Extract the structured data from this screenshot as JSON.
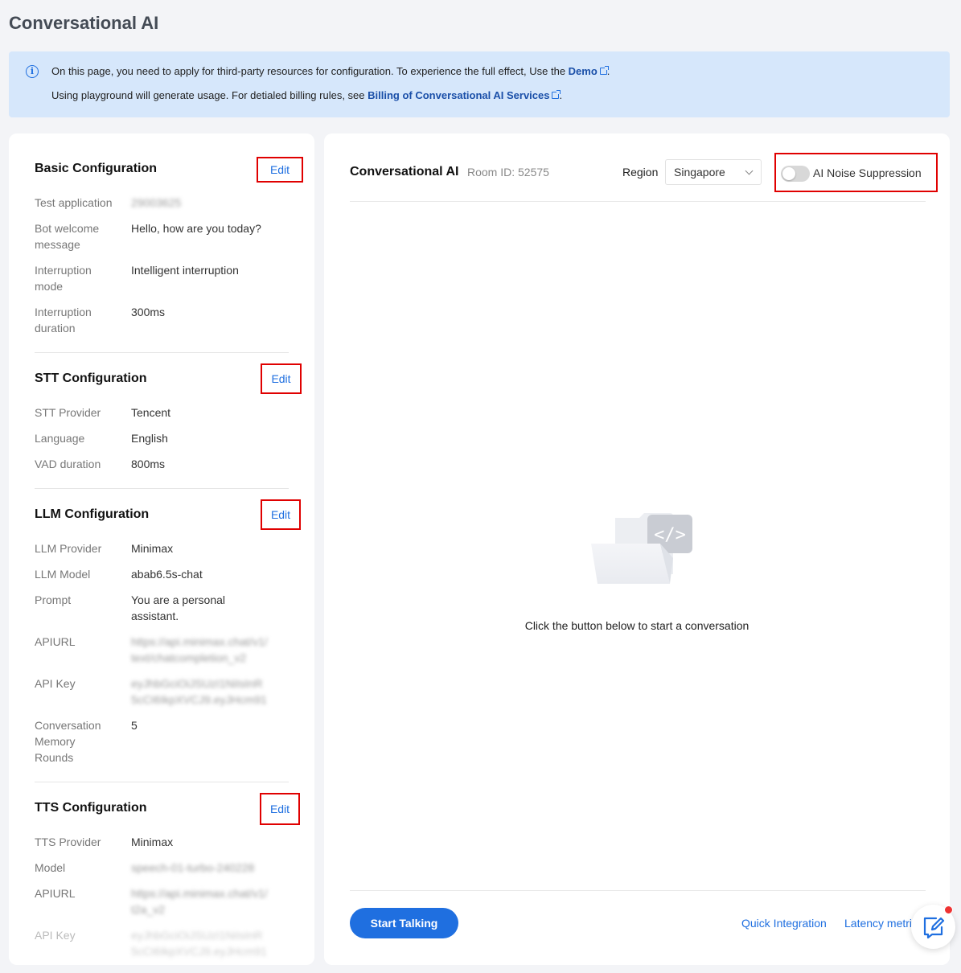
{
  "page": {
    "title": "Conversational AI"
  },
  "notice": {
    "line1_text": "On this page, you need to apply for third-party resources for configuration. To experience the full effect, Use the ",
    "line1_link": "Demo",
    "line2_text": "Using playground will generate usage. For detialed billing rules, see ",
    "line2_link": "Billing of Conversational AI Services"
  },
  "basic": {
    "title": "Basic Configuration",
    "edit_label": "Edit",
    "rows": [
      {
        "label": "Test application",
        "value": "29003625"
      },
      {
        "label": "Bot welcome message",
        "value": "Hello, how are you today?"
      },
      {
        "label": "Interruption mode",
        "value": "Intelligent interruption"
      },
      {
        "label": "Interruption duration",
        "value": "300ms"
      }
    ]
  },
  "stt": {
    "title": "STT Configuration",
    "edit_label": "Edit",
    "rows": [
      {
        "label": "STT Provider",
        "value": "Tencent"
      },
      {
        "label": "Language",
        "value": "English"
      },
      {
        "label": "VAD duration",
        "value": "800ms"
      }
    ]
  },
  "llm": {
    "title": "LLM Configuration",
    "edit_label": "Edit",
    "rows": [
      {
        "label": "LLM Provider",
        "value": "Minimax"
      },
      {
        "label": "LLM Model",
        "value": "abab6.5s-chat"
      },
      {
        "label": "Prompt",
        "value": "You are a personal assistant."
      },
      {
        "label": "APIURL",
        "value": "https://api.minimax.chat/v1/text/chatcompletion_v2"
      },
      {
        "label": "API Key",
        "value": "eyJhbGciOiJSUzI1NiIsInR5cCI6IkpXVCJ9.eyJHcm91cE..."
      },
      {
        "label": "Conversation Memory Rounds",
        "value": "5"
      }
    ]
  },
  "tts": {
    "title": "TTS Configuration",
    "edit_label": "Edit",
    "rows": [
      {
        "label": "TTS Provider",
        "value": "Minimax"
      },
      {
        "label": "Model",
        "value": "speech-01-turbo-240228"
      },
      {
        "label": "APIURL",
        "value": "https://api.minimax.chat/v1/t2a_v2"
      },
      {
        "label": "API Key",
        "value": "eyJhbGciOiJSUzI1NiIsInR5cCI6IkpXVCJ9.eyJHcm91c"
      }
    ]
  },
  "main": {
    "title": "Conversational AI",
    "room_id": "Room ID: 52575",
    "region_label": "Region",
    "region_value": "Singapore",
    "noise_label": "AI Noise Suppression",
    "noise_enabled": false,
    "empty_text": "Click the button below to start a conversation",
    "start_button": "Start Talking",
    "quick_link": "Quick Integration",
    "latency_link": "Latency metrics"
  },
  "icons": {
    "info": "info-icon",
    "external": "external-link-icon",
    "chevron": "chevron-down-icon",
    "feedback": "feedback-edit-icon"
  },
  "colors": {
    "accent": "#1f6fe0",
    "notice_bg": "#d6e7fb",
    "highlight": "#e00000"
  }
}
